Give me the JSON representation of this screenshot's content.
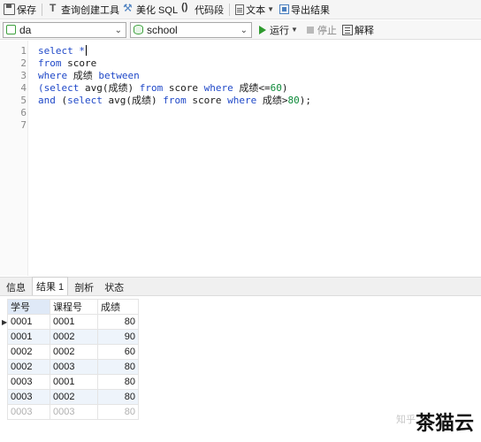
{
  "toolbar": {
    "save": "保存",
    "query_builder": "查询创建工具",
    "beautify": "美化 SQL",
    "code_snippet": "代码段",
    "text": "文本",
    "export": "导出结果"
  },
  "connection": {
    "connection_value": "da",
    "database_value": "school",
    "run": "运行",
    "stop": "停止",
    "explain": "解释"
  },
  "editor": {
    "line_numbers": [
      "1",
      "2",
      "3",
      "4",
      "5",
      "6",
      "7"
    ],
    "lines": [
      [
        {
          "t": "select *",
          "c": "kw"
        }
      ],
      [
        {
          "t": "from",
          "c": "kw"
        },
        {
          "t": " score",
          "c": "plain"
        }
      ],
      [
        {
          "t": "where",
          "c": "kw"
        },
        {
          "t": " 成绩 ",
          "c": "plain"
        },
        {
          "t": "between",
          "c": "kw"
        }
      ],
      [
        {
          "t": "(select",
          "c": "kw"
        },
        {
          "t": " avg(成绩) ",
          "c": "plain"
        },
        {
          "t": "from",
          "c": "kw"
        },
        {
          "t": " score ",
          "c": "plain"
        },
        {
          "t": "where",
          "c": "kw"
        },
        {
          "t": " 成绩<=",
          "c": "plain"
        },
        {
          "t": "60",
          "c": "num"
        },
        {
          "t": ")",
          "c": "plain"
        }
      ],
      [
        {
          "t": "and",
          "c": "kw"
        },
        {
          "t": " (",
          "c": "plain"
        },
        {
          "t": "select",
          "c": "kw"
        },
        {
          "t": " avg(成绩) ",
          "c": "plain"
        },
        {
          "t": "from",
          "c": "kw"
        },
        {
          "t": " score ",
          "c": "plain"
        },
        {
          "t": "where",
          "c": "kw"
        },
        {
          "t": " 成绩>",
          "c": "plain"
        },
        {
          "t": "80",
          "c": "num"
        },
        {
          "t": ");",
          "c": "plain"
        }
      ],
      [],
      []
    ]
  },
  "tabs": [
    "信息",
    "结果 1",
    "剖析",
    "状态"
  ],
  "active_tab": "结果 1",
  "results": {
    "columns": [
      "学号",
      "课程号",
      "成绩"
    ],
    "rows": [
      [
        "0001",
        "0001",
        "80"
      ],
      [
        "0001",
        "0002",
        "90"
      ],
      [
        "0002",
        "0002",
        "60"
      ],
      [
        "0002",
        "0003",
        "80"
      ],
      [
        "0003",
        "0001",
        "80"
      ],
      [
        "0003",
        "0002",
        "80"
      ],
      [
        "0003",
        "0003",
        "80"
      ]
    ]
  },
  "watermark": {
    "site": "知乎",
    "brand": "茶猫云"
  },
  "colors": {
    "keyword": "#1f48c8",
    "number": "#0e8a3a",
    "run_green": "#2e9a2e",
    "alt_row": "#eef4fb"
  }
}
